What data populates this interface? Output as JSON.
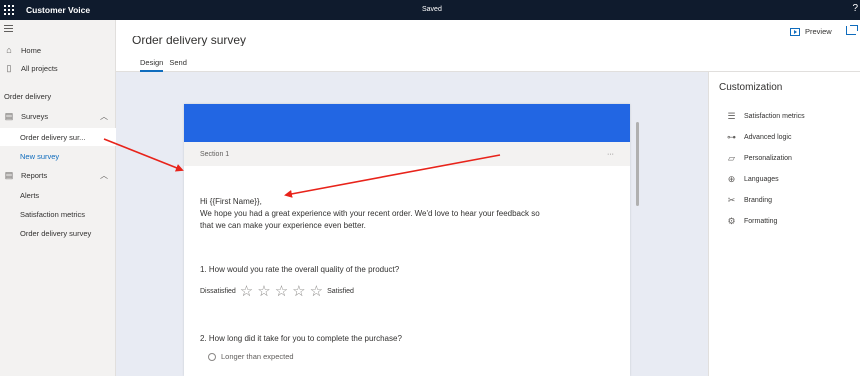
{
  "topbar": {
    "app_title": "Customer Voice",
    "status": "Saved",
    "help": "?"
  },
  "nav": {
    "home": "Home",
    "all_projects": "All projects",
    "section_header": "Order delivery",
    "surveys": "Surveys",
    "survey_item": "Order delivery sur...",
    "new_survey": "New survey",
    "reports": "Reports",
    "alerts": "Alerts",
    "satisfaction_metrics": "Satisfaction metrics",
    "order_delivery_survey": "Order delivery survey"
  },
  "header": {
    "title": "Order delivery survey",
    "tabs": [
      {
        "label": "Design"
      },
      {
        "label": "Send"
      }
    ],
    "preview": "Preview"
  },
  "survey": {
    "section": "Section 1",
    "more": "···",
    "greeting": "Hi {{First Name}},",
    "intro_line1": "We hope you had a great experience with your recent order. We'd love to hear your feedback so",
    "intro_line2": "that we can make your experience even better.",
    "q1": "1. How would you rate the overall quality of the product?",
    "q1_low": "Dissatisfied",
    "q1_high": "Satisfied",
    "q1_stars": 5,
    "q2": "2. How long did it take for you to complete the purchase?",
    "q2_option1": "Longer than expected"
  },
  "panel": {
    "title": "Customization",
    "items": [
      {
        "label": "Satisfaction metrics",
        "icon": "satisfaction-icon"
      },
      {
        "label": "Advanced logic",
        "icon": "logic-icon"
      },
      {
        "label": "Personalization",
        "icon": "personalization-icon"
      },
      {
        "label": "Languages",
        "icon": "globe-icon"
      },
      {
        "label": "Branding",
        "icon": "branding-icon"
      },
      {
        "label": "Formatting",
        "icon": "gear-icon"
      }
    ]
  },
  "colors": {
    "topbar": "#0f1b2d",
    "banner": "#2266e3",
    "accent": "#0f6cbd",
    "arrow": "#e8231a"
  }
}
